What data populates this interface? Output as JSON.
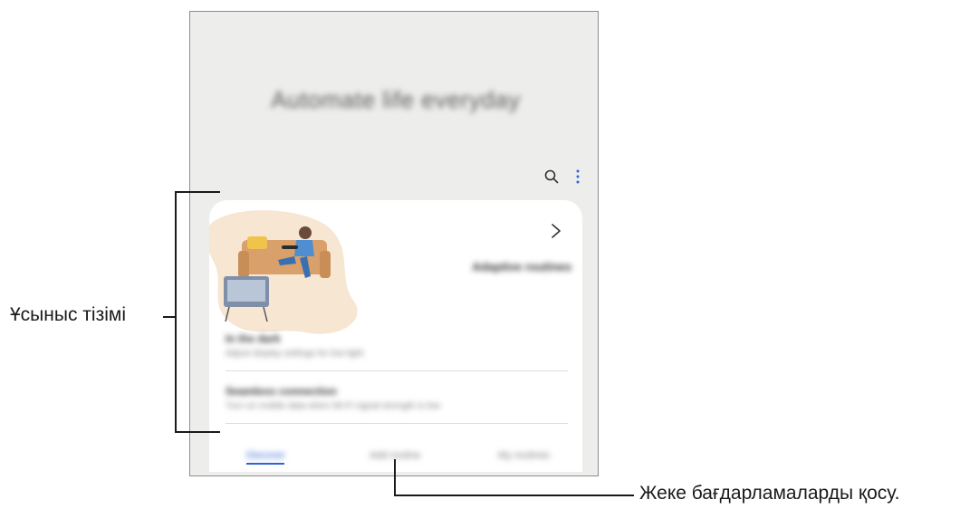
{
  "header": {
    "title": "Automate life everyday",
    "search_icon": "search-icon",
    "more_icon": "more-options-icon"
  },
  "hero": {
    "label": "Adaptive routines",
    "illustration": "person-on-sofa-illustration",
    "chevron_icon": "chevron-right-icon"
  },
  "recommendations": [
    {
      "title": "In the dark",
      "subtitle": "Adjust display settings for low light"
    },
    {
      "title": "Seamless connection",
      "subtitle": "Turn on mobile data when Wi-Fi signal strength is low"
    }
  ],
  "tabs": [
    {
      "label": "Discover",
      "active": true
    },
    {
      "label": "Add routine",
      "active": false
    },
    {
      "label": "My routines",
      "active": false
    }
  ],
  "callouts": {
    "recommendation_list": "Ұсыныс тізімі",
    "add_routine": "Жеке бағдарламаларды қосу."
  },
  "colors": {
    "accent": "#2e63d6",
    "screen_bg": "#ededeb",
    "card_bg": "#ffffff",
    "illustration_sofa": "#d9a06b",
    "illustration_blob": "#f6e6d2"
  }
}
